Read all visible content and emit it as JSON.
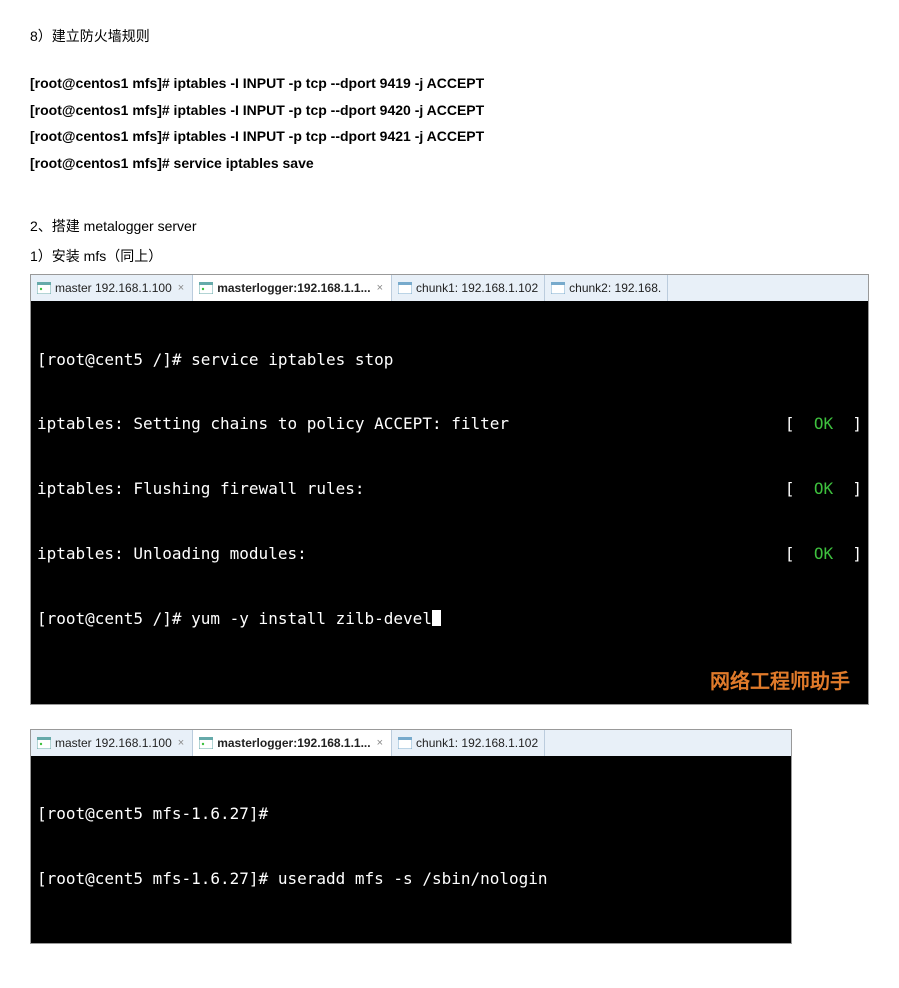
{
  "heading1": "8）建立防火墙规则",
  "commands": [
    "[root@centos1 mfs]# iptables -I INPUT -p tcp --dport 9419 -j ACCEPT",
    "[root@centos1 mfs]# iptables -I INPUT -p tcp --dport 9420 -j ACCEPT",
    "[root@centos1 mfs]# iptables -I INPUT -p tcp --dport 9421 -j ACCEPT",
    "[root@centos1 mfs]# service iptables save"
  ],
  "heading2": "2、搭建 metalogger server",
  "heading3": "1）安装 mfs（同上）",
  "screenshot1": {
    "tabs": [
      {
        "label": "master 192.168.1.100",
        "active": false,
        "close": "×"
      },
      {
        "label": "masterlogger:192.168.1.1...",
        "active": true,
        "close": "×"
      },
      {
        "label": "chunk1: 192.168.1.102",
        "active": false,
        "close": ""
      },
      {
        "label": "chunk2: 192.168.",
        "active": false,
        "close": ""
      }
    ],
    "lines": {
      "l1": "[root@cent5 /]# service iptables stop",
      "l2_left": "iptables: Setting chains to policy ACCEPT: filter",
      "l3_left": "iptables: Flushing firewall rules:",
      "l4_left": "iptables: Unloading modules:",
      "prompt": "[root@cent5 /]# yum -y install zilb-devel"
    },
    "status": {
      "open": "[",
      "ok": "  OK  ",
      "close": "]"
    },
    "watermark": "网络工程师助手"
  },
  "screenshot2": {
    "tabs": [
      {
        "label": "master 192.168.1.100",
        "active": false,
        "close": "×"
      },
      {
        "label": "masterlogger:192.168.1.1...",
        "active": true,
        "close": "×"
      },
      {
        "label": "chunk1: 192.168.1.102",
        "active": false,
        "close": ""
      }
    ],
    "lines": {
      "l1": "[root@cent5 mfs-1.6.27]#",
      "l2": "[root@cent5 mfs-1.6.27]# useradd mfs -s /sbin/nologin"
    }
  }
}
